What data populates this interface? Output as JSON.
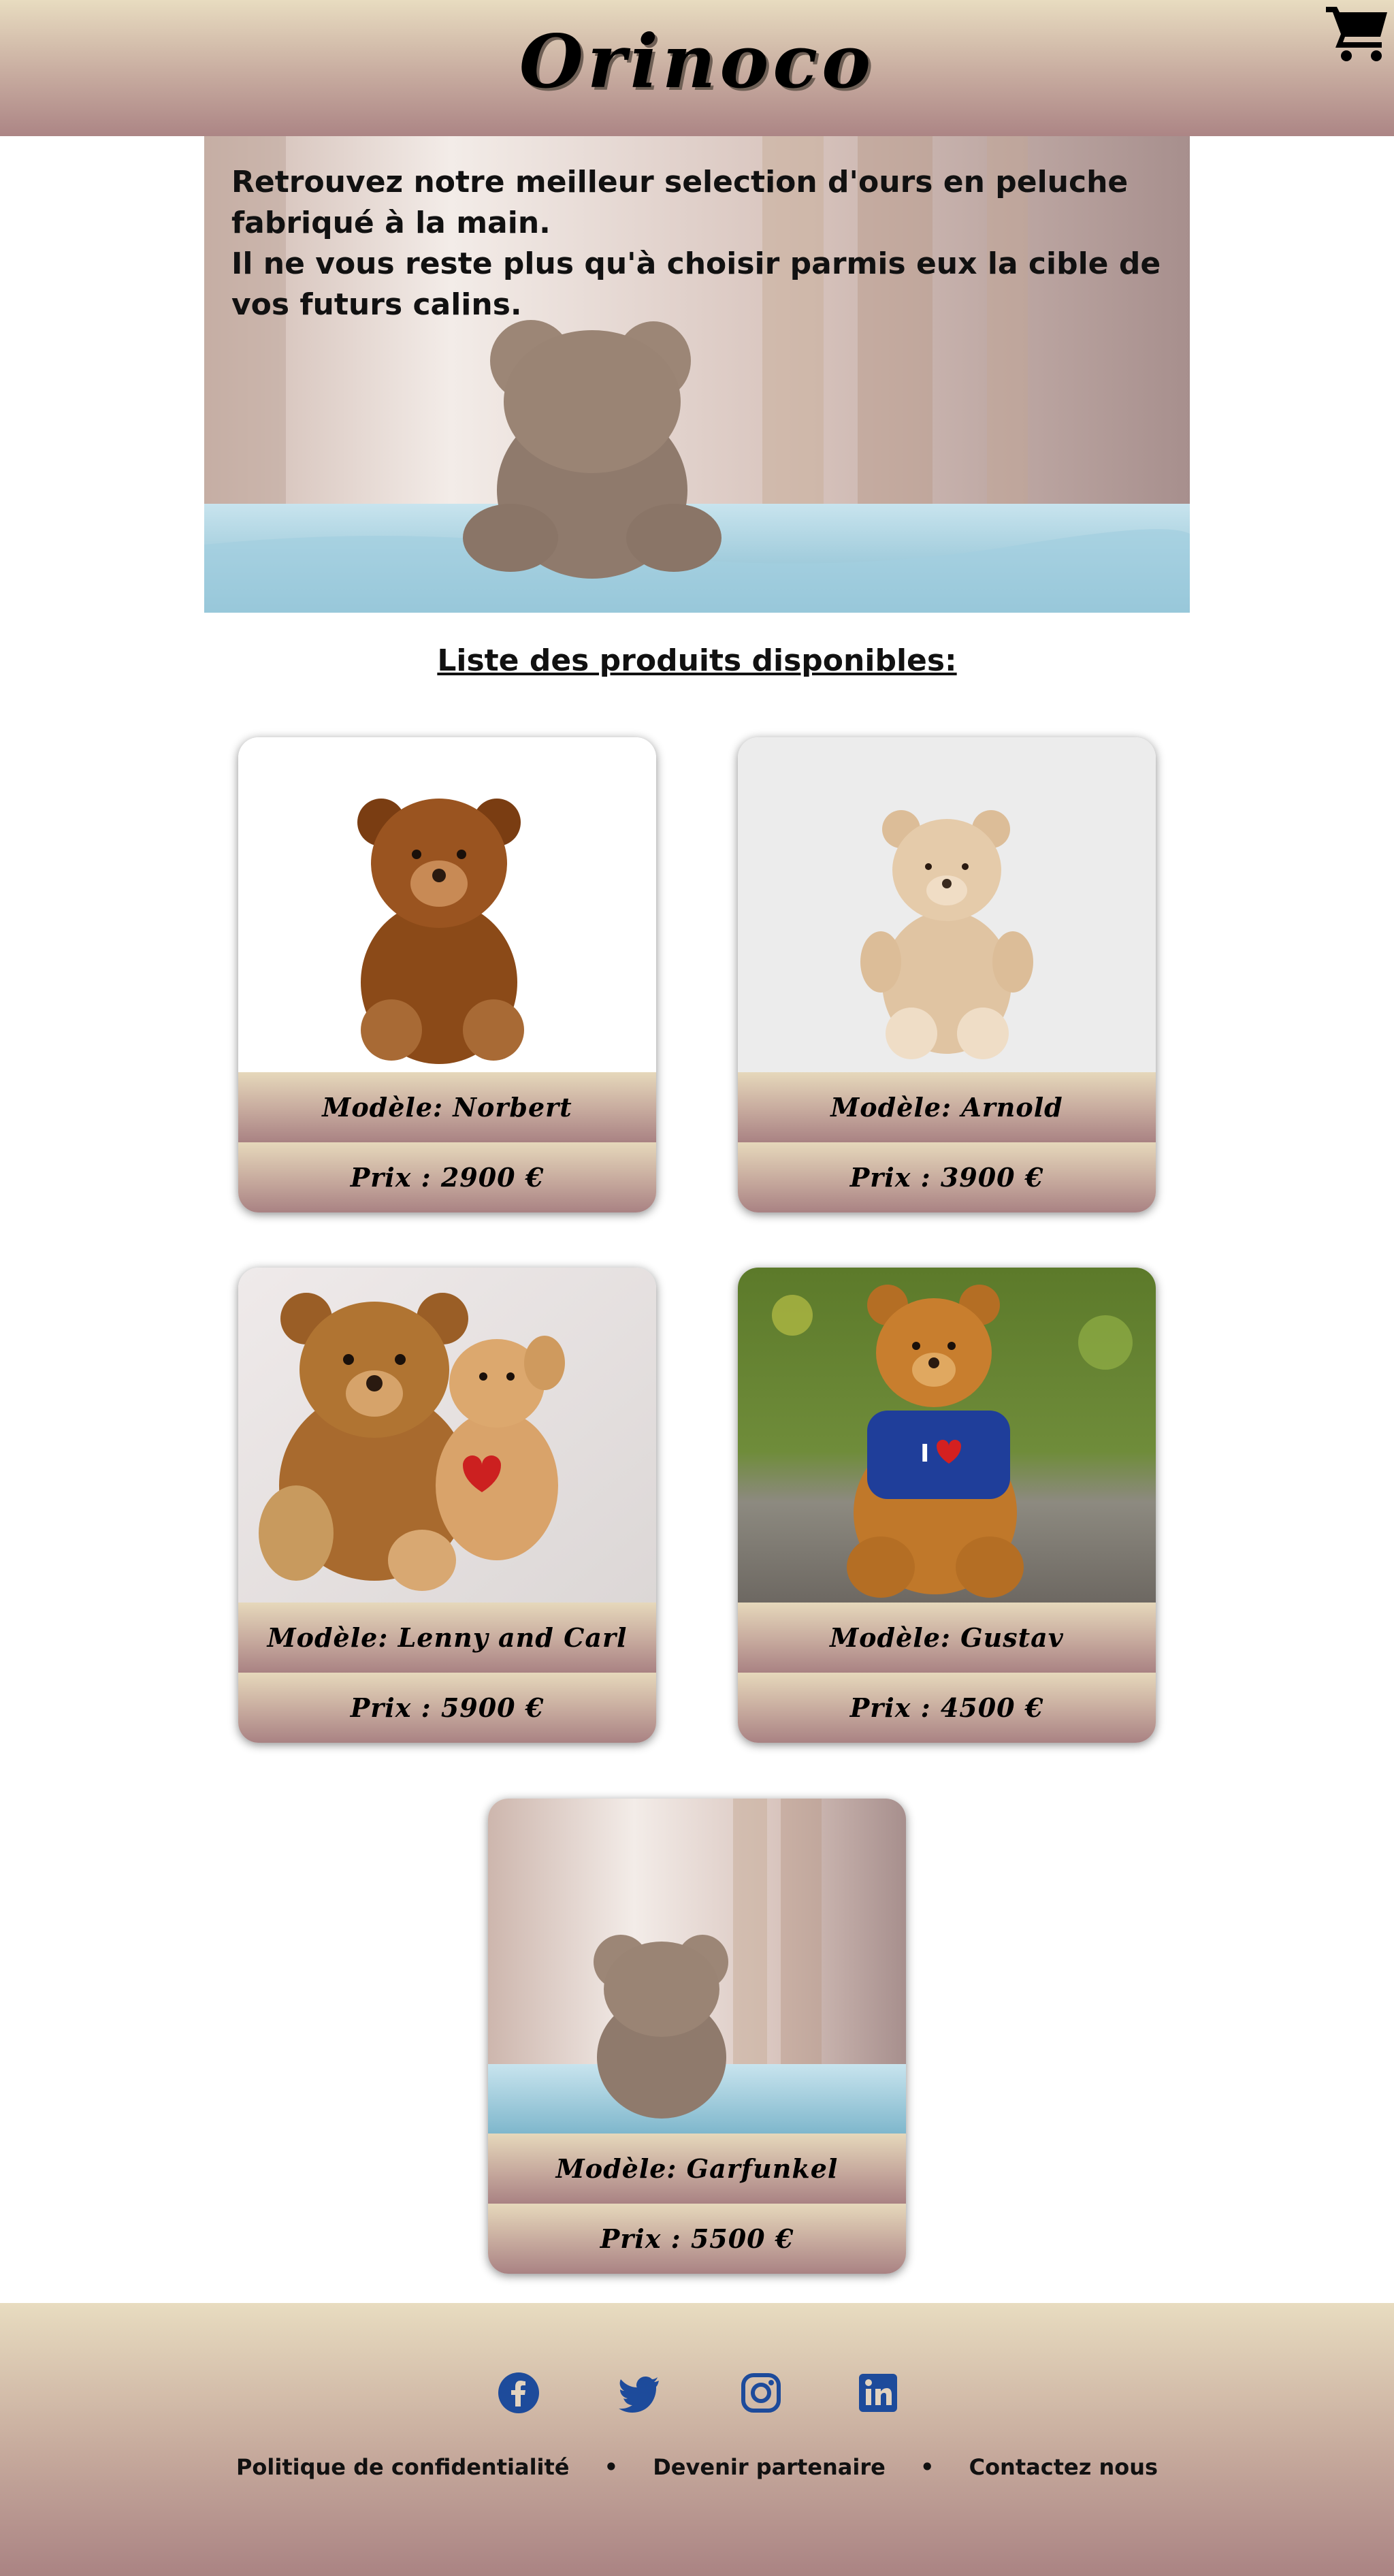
{
  "header": {
    "logo": "Orinoco",
    "cart_icon": "shopping-cart-icon"
  },
  "hero": {
    "line1": "Retrouvez notre meilleur selection d'ours en peluche fabriqué à la main.",
    "line2": "Il ne vous reste plus qu'à choisir parmis eux la cible de vos futurs calins."
  },
  "list_title": "Liste des produits disponibles:",
  "products": [
    {
      "name": "Modèle: Norbert",
      "price": "Prix : 2900 €"
    },
    {
      "name": "Modèle: Arnold",
      "price": "Prix : 3900 €"
    },
    {
      "name": "Modèle: Lenny and Carl",
      "price": "Prix : 5900 €"
    },
    {
      "name": "Modèle: Gustav",
      "price": "Prix : 4500 €"
    },
    {
      "name": "Modèle: Garfunkel",
      "price": "Prix : 5500 €"
    }
  ],
  "footer": {
    "social_icons": [
      "facebook-icon",
      "twitter-icon",
      "instagram-icon",
      "linkedin-icon"
    ],
    "links": [
      "Politique de confidentialité",
      "Devenir partenaire",
      "Contactez nous"
    ],
    "separator": "•",
    "social_color": "#1d4b9b"
  }
}
